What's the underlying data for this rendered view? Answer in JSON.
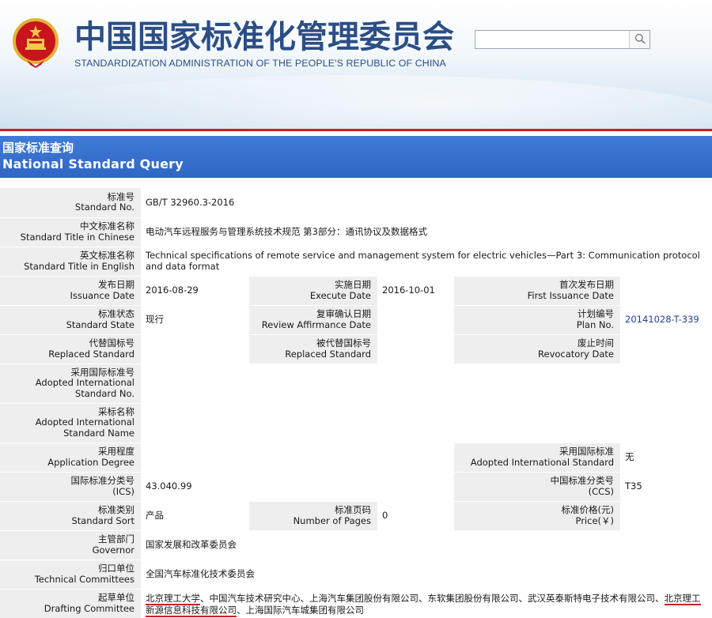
{
  "header": {
    "title_cn": "中国国家标准化管理委员会",
    "title_en": "STANDARDIZATION ADMINISTRATION OF THE PEOPLE'S REPUBLIC OF CHINA",
    "search": {
      "value": "",
      "placeholder": ""
    },
    "icons": {
      "emblem": "national-emblem-icon",
      "search": "search-icon"
    }
  },
  "banner": {
    "title_cn": "国家标准查询",
    "title_en": "National Standard Query"
  },
  "fields": {
    "standard_no": {
      "label_cn": "标准号",
      "label_en": "Standard No.",
      "value": "GB/T 32960.3-2016"
    },
    "title_cn": {
      "label_cn": "中文标准名称",
      "label_en": "Standard Title in Chinese",
      "value": "电动汽车远程服务与管理系统技术规范 第3部分：通讯协议及数据格式"
    },
    "title_en": {
      "label_cn": "英文标准名称",
      "label_en": "Standard Title in English",
      "value": "Technical specifications of remote service and management system for electric vehicles—Part 3: Communication protocol and data format"
    },
    "issuance_date": {
      "label_cn": "发布日期",
      "label_en": "Issuance Date",
      "value": "2016-08-29"
    },
    "execute_date": {
      "label_cn": "实施日期",
      "label_en": "Execute Date",
      "value": "2016-10-01"
    },
    "first_issuance_date": {
      "label_cn": "首次发布日期",
      "label_en": "First Issuance Date",
      "value": ""
    },
    "standard_state": {
      "label_cn": "标准状态",
      "label_en": "Standard State",
      "value": "现行"
    },
    "review_affirmance_date": {
      "label_cn": "复审确认日期",
      "label_en": "Review Affirmance Date",
      "value": ""
    },
    "plan_no": {
      "label_cn": "计划编号",
      "label_en": "Plan No.",
      "value": "20141028-T-339"
    },
    "replaced_standard": {
      "label_cn": "代替国标号",
      "label_en": "Replaced Standard",
      "value": ""
    },
    "replaced_by": {
      "label_cn": "被代替国标号",
      "label_en": "Replaced Standard",
      "value": ""
    },
    "revocatory_date": {
      "label_cn": "废止时间",
      "label_en": "Revocatory Date",
      "value": ""
    },
    "adopted_intl_no": {
      "label_cn": "采用国际标准号",
      "label_en_1": "Adopted International",
      "label_en_2": "Standard No.",
      "value": ""
    },
    "adopted_intl_name": {
      "label_cn": "采标名称",
      "label_en_1": "Adopted International",
      "label_en_2": "Standard Name",
      "value": ""
    },
    "application_degree": {
      "label_cn": "采用程度",
      "label_en": "Application Degree",
      "value": ""
    },
    "adopted_intl_standard": {
      "label_cn": "采用国际标准",
      "label_en": "Adopted International Standard",
      "value": "无"
    },
    "ics": {
      "label_cn": "国际标准分类号",
      "label_en": "(ICS)",
      "value": "43.040.99"
    },
    "ccs": {
      "label_cn": "中国标准分类号",
      "label_en": "(CCS)",
      "value": "T35"
    },
    "standard_sort": {
      "label_cn": "标准类别",
      "label_en": "Standard Sort",
      "value": "产品"
    },
    "number_of_pages": {
      "label_cn": "标准页码",
      "label_en": "Number of Pages",
      "value": "0"
    },
    "price": {
      "label_cn": "标准价格(元)",
      "label_en": "Price(￥)",
      "value": ""
    },
    "governor": {
      "label_cn": "主管部门",
      "label_en": "Governor",
      "value": "国家发展和改革委员会"
    },
    "technical_committees": {
      "label_cn": "归口单位",
      "label_en": "Technical Committees",
      "value": "全国汽车标准化技术委员会"
    },
    "drafting_committee": {
      "label_cn": "起草单位",
      "label_en": "Drafting Committee",
      "parts": [
        "北京理工大学",
        "、中国汽车技术研究中心、上海汽车集团股份有限公司、东软集团股份有限公司、武汉英泰斯特电子技术有限公司、",
        "北京理工新源信息科技有限公司",
        "、上海国际汽车城集团有限公司"
      ]
    }
  },
  "colors": {
    "banner": "#2f67c3",
    "title_text": "#2c4e86",
    "red_rule": "#cc1f1f",
    "label_bg": "#eeeeee",
    "link": "#1f3f9e"
  }
}
